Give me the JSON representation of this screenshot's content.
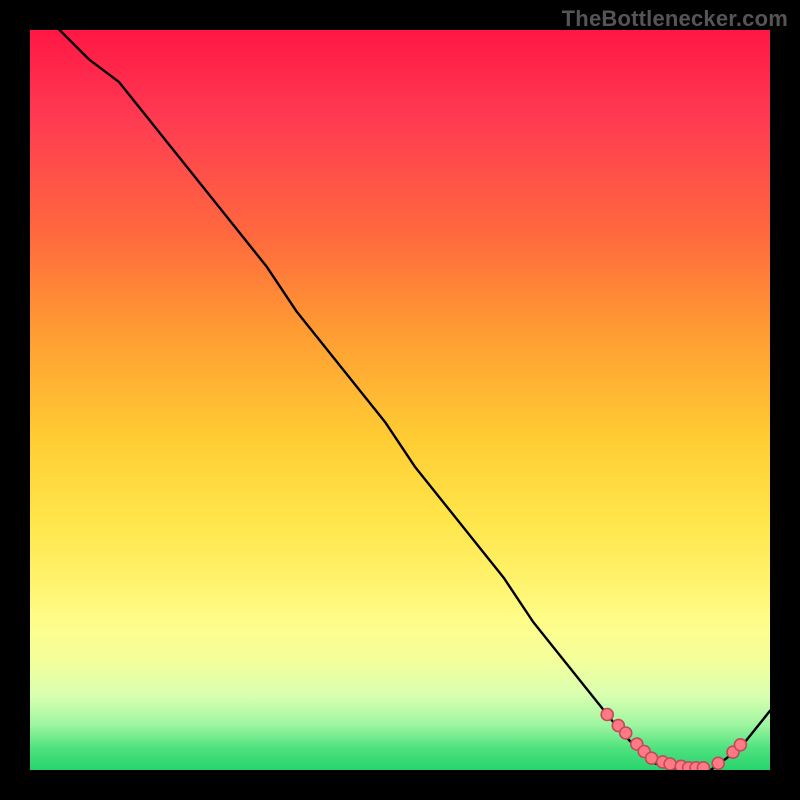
{
  "brand": "TheBottlenecker.com",
  "colors": {
    "background": "#000000",
    "curve": "#000000",
    "marker_fill": "#ff7a85",
    "marker_stroke": "#c24a5a",
    "gradient_top": "#ff1744",
    "gradient_bottom": "#27d46e"
  },
  "chart_data": {
    "type": "line",
    "title": "",
    "xlabel": "",
    "ylabel": "",
    "xlim": [
      0,
      100
    ],
    "ylim": [
      0,
      100
    ],
    "x": [
      4,
      8,
      12,
      16,
      20,
      24,
      28,
      32,
      36,
      40,
      44,
      48,
      52,
      56,
      60,
      64,
      68,
      72,
      76,
      80,
      84,
      88,
      92,
      96,
      100
    ],
    "values": [
      100,
      96,
      93,
      88,
      83,
      78,
      73,
      68,
      62,
      57,
      52,
      47,
      41,
      36,
      31,
      26,
      20,
      15,
      10,
      5,
      1,
      0,
      0,
      3,
      8
    ],
    "markers": {
      "x": [
        78,
        79.5,
        80.5,
        82,
        83,
        84,
        85.5,
        86.5,
        88,
        89,
        90,
        91,
        93,
        95,
        96
      ],
      "y": [
        7.5,
        6,
        5,
        3.5,
        2.5,
        1.6,
        1.1,
        0.8,
        0.5,
        0.3,
        0.3,
        0.3,
        0.9,
        2.4,
        3.4
      ]
    }
  }
}
